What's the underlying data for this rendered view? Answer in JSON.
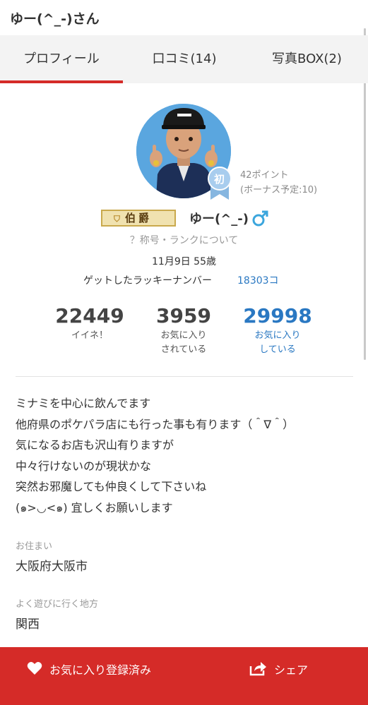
{
  "header": {
    "title": "ゆー(^_-)さん"
  },
  "tabs": [
    {
      "label": "プロフィール",
      "active": true
    },
    {
      "label": "口コミ(14)",
      "active": false
    },
    {
      "label": "写真BOX(2)",
      "active": false
    }
  ],
  "profile": {
    "badge_label": "初",
    "points": "42ポイント",
    "bonus": "(ボーナス予定:10)",
    "rank": "伯爵",
    "name": "ゆー(^_-)",
    "rank_help": "？称号・ランクについて",
    "birthday": "11月9日 55歳",
    "lucky_label": "ゲットしたラッキーナンバー",
    "lucky_value": "18303コ"
  },
  "stats": [
    {
      "value": "22449",
      "label_lines": [
        "イイネ！"
      ]
    },
    {
      "value": "3959",
      "label_lines": [
        "お気に入り",
        "されている"
      ]
    },
    {
      "value": "29998",
      "label_lines": [
        "お気に入り",
        "している"
      ]
    }
  ],
  "intro_lines": [
    "ミナミを中心に飲んでます",
    "他府県のポケパラ店にも行った事も有ります（＾∇＾）",
    "気になるお店も沢山有りますが",
    "中々行けないのが現状かな",
    "突然お邪魔しても仲良くして下さいね",
    "(๑>◡<๑) 宜しくお願いします"
  ],
  "residence": {
    "label": "お住まい",
    "value": "大阪府大阪市"
  },
  "area": {
    "label": "よく遊びに行く地方",
    "value": "関西"
  },
  "actions": {
    "favorite_label": "お気に入り登録済み",
    "share_label": "シェア"
  },
  "colors": {
    "accent_red": "#d52b28",
    "link_blue": "#2a78c2",
    "avatar_bg": "#5aa6df"
  }
}
